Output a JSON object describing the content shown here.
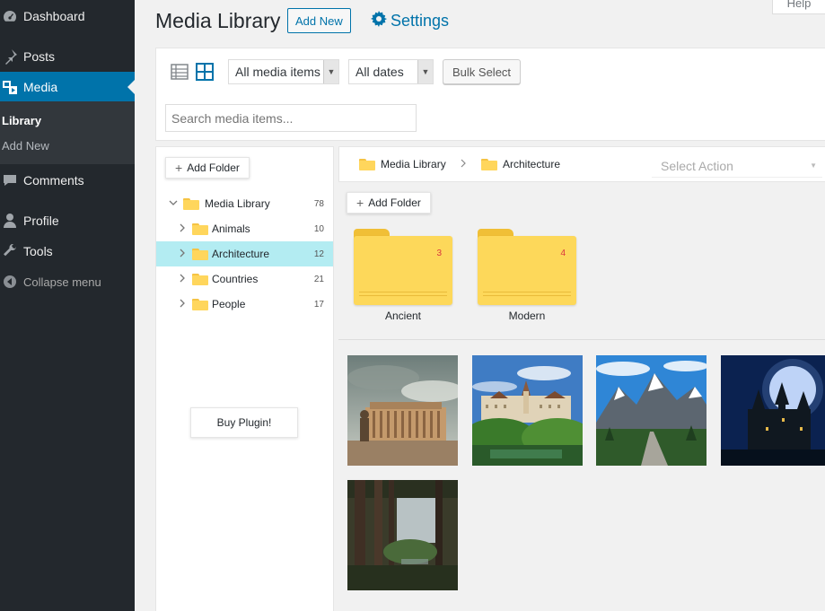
{
  "sidebar": {
    "items": [
      {
        "label": "Dashboard",
        "icon": "dashboard-icon"
      },
      {
        "label": "Posts",
        "icon": "pin-icon"
      },
      {
        "label": "Media",
        "icon": "media-icon"
      },
      {
        "label": "Comments",
        "icon": "comment-icon"
      },
      {
        "label": "Profile",
        "icon": "user-icon"
      },
      {
        "label": "Tools",
        "icon": "wrench-icon"
      },
      {
        "label": "Collapse menu",
        "icon": "collapse-icon"
      }
    ],
    "submenu": [
      "Library",
      "Add New"
    ]
  },
  "header": {
    "title": "Media Library",
    "add_new": "Add New",
    "settings": "Settings",
    "help": "Help"
  },
  "toolbar": {
    "filter_type": "All media items",
    "filter_date": "All dates",
    "bulk_select": "Bulk Select",
    "search_placeholder": "Search media items..."
  },
  "tree": {
    "add_folder": "Add Folder",
    "root": {
      "label": "Media Library",
      "count": "78"
    },
    "children": [
      {
        "label": "Animals",
        "count": "10"
      },
      {
        "label": "Architecture",
        "count": "12"
      },
      {
        "label": "Countries",
        "count": "21"
      },
      {
        "label": "People",
        "count": "17"
      }
    ],
    "buy_plugin": "Buy Plugin!"
  },
  "main": {
    "breadcrumb": [
      "Media Library",
      "Architecture"
    ],
    "select_action": "Select Action",
    "add_folder": "Add Folder",
    "folders": [
      {
        "name": "Ancient",
        "count": "3"
      },
      {
        "name": "Modern",
        "count": "4"
      }
    ],
    "images": [
      "roman-monument-photo",
      "castle-lake-photo",
      "mountain-road-photo",
      "night-castle-moon-photo",
      "forest-trees-photo"
    ]
  },
  "colors": {
    "sidebar_bg": "#23282d",
    "accent": "#0073aa",
    "selected_row": "#b3ecf2",
    "folder": "#fdd85a",
    "folder_count": "#d9363e"
  }
}
